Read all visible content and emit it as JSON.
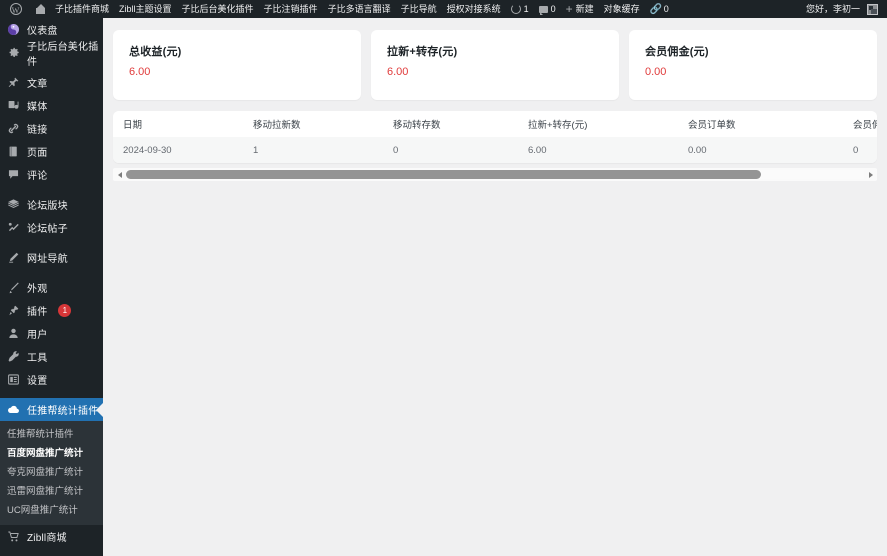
{
  "adminbar": {
    "logo_icon": "wordpress-logo-icon",
    "home_icon": "home-icon",
    "items": [
      {
        "label": "子比插件商城",
        "icon": null
      },
      {
        "label": "Zibll主题设置",
        "icon": null
      },
      {
        "label": "子比后台美化插件",
        "icon": null
      },
      {
        "label": "子比注销插件",
        "icon": null
      },
      {
        "label": "子比多语言翻译",
        "icon": null
      },
      {
        "label": "子比导航",
        "icon": null
      },
      {
        "label": "授权对接系统",
        "icon": null
      }
    ],
    "updates": {
      "icon": "update-icon",
      "count": "1"
    },
    "comments": {
      "icon": "comment-bubble-icon",
      "count": "0"
    },
    "new": {
      "icon": "plus-icon",
      "label": "新建"
    },
    "object_cache": {
      "label": "对象缓存"
    },
    "links": {
      "icon": "link-icon",
      "count": "0"
    },
    "greeting": "您好，李初一",
    "avatar": "user-avatar"
  },
  "sidebar": {
    "items": [
      {
        "label": "仪表盘",
        "icon": "dashboard-icon",
        "active": false,
        "group": 0
      },
      {
        "label": "子比后台美化插件",
        "icon": "gear-icon",
        "active": false,
        "group": 1
      },
      {
        "label": "文章",
        "icon": "pin-icon",
        "active": false,
        "group": 2
      },
      {
        "label": "媒体",
        "icon": "media-icon",
        "active": false,
        "group": 2
      },
      {
        "label": "链接",
        "icon": "link-icon",
        "active": false,
        "group": 2
      },
      {
        "label": "页面",
        "icon": "page-icon",
        "active": false,
        "group": 2
      },
      {
        "label": "评论",
        "icon": "comment-bubble-icon",
        "active": false,
        "group": 2
      },
      {
        "label": "论坛版块",
        "icon": "forum-icon",
        "active": false,
        "group": 3
      },
      {
        "label": "论坛帖子",
        "icon": "forum-post-icon",
        "active": false,
        "group": 3
      },
      {
        "label": "网址导航",
        "icon": "nav-pencil-icon",
        "active": false,
        "group": 4
      },
      {
        "label": "外观",
        "icon": "appearance-brush-icon",
        "active": false,
        "group": 5
      },
      {
        "label": "插件",
        "icon": "plugins-icon",
        "active": false,
        "badge": "1",
        "group": 5
      },
      {
        "label": "用户",
        "icon": "user-icon",
        "active": false,
        "group": 5
      },
      {
        "label": "工具",
        "icon": "tools-wrench-icon",
        "active": false,
        "group": 5
      },
      {
        "label": "设置",
        "icon": "settings-sliders-icon",
        "active": false,
        "group": 5
      },
      {
        "label": "任推帮统计插件",
        "icon": "cloud-icon",
        "active": true,
        "group": 6
      }
    ],
    "submenu": [
      {
        "label": "任推帮统计插件",
        "current": false
      },
      {
        "label": "百度网盘推广统计",
        "current": true
      },
      {
        "label": "夸克网盘推广统计",
        "current": false
      },
      {
        "label": "迅雷网盘推广统计",
        "current": false
      },
      {
        "label": "UC网盘推广统计",
        "current": false
      }
    ],
    "bottom_items": [
      {
        "label": "Zibll商城",
        "icon": "cart-icon",
        "active": false
      }
    ]
  },
  "main": {
    "cards": [
      {
        "title": "总收益(元)",
        "value": "6.00"
      },
      {
        "title": "拉新+转存(元)",
        "value": "6.00"
      },
      {
        "title": "会员佣金(元)",
        "value": "0.00"
      }
    ],
    "table": {
      "columns": [
        "日期",
        "移动拉新数",
        "移动转存数",
        "拉新+转存(元)",
        "会员订单数",
        "会员佣金(元)",
        ""
      ],
      "rows": [
        [
          "2024-09-30",
          "1",
          "0",
          "6.00",
          "0.00",
          "0",
          ""
        ]
      ]
    },
    "scrollbar": {
      "left_arrow": "scroll-left-arrow-icon",
      "right_arrow": "scroll-right-arrow-icon",
      "thumb_position": "0%"
    }
  },
  "colors": {
    "admin_dark": "#1d2327",
    "submenu_dark": "#2c3338",
    "accent_blue": "#2271b1",
    "value_red": "#e03b3b",
    "badge_red": "#d63638",
    "page_bg": "#f0f0f1"
  }
}
